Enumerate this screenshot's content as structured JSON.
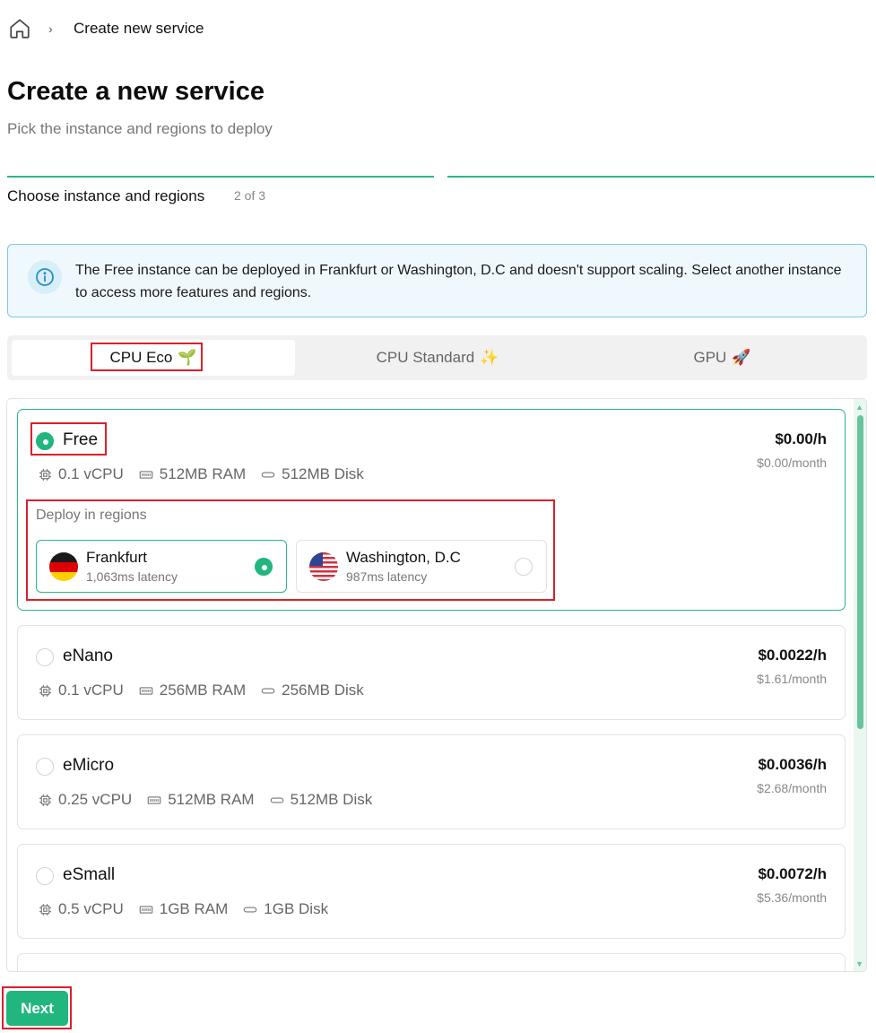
{
  "breadcrumb": {
    "home_icon": "home-icon",
    "separator": "›",
    "current": "Create new service"
  },
  "header": {
    "title": "Create a new service",
    "subtitle": "Pick the instance and regions to deploy"
  },
  "steps": {
    "label": "Choose instance and regions",
    "count": "2 of 3",
    "current": 2,
    "total": 3
  },
  "info": {
    "icon": "info-icon",
    "text": "The Free instance can be deployed in Frankfurt or Washington, D.C and doesn't support scaling. Select another instance to access more features and regions."
  },
  "tabs": [
    {
      "label": "CPU Eco",
      "emoji": "🌱",
      "active": true
    },
    {
      "label": "CPU Standard",
      "emoji": "✨",
      "active": false
    },
    {
      "label": "GPU",
      "emoji": "🚀",
      "active": false
    }
  ],
  "instances": [
    {
      "name": "Free",
      "selected": true,
      "cpu": "0.1 vCPU",
      "ram": "512MB RAM",
      "disk": "512MB Disk",
      "price": "$0.00/h",
      "month": "$0.00/month"
    },
    {
      "name": "eNano",
      "selected": false,
      "cpu": "0.1 vCPU",
      "ram": "256MB RAM",
      "disk": "256MB Disk",
      "price": "$0.0022/h",
      "month": "$1.61/month"
    },
    {
      "name": "eMicro",
      "selected": false,
      "cpu": "0.25 vCPU",
      "ram": "512MB RAM",
      "disk": "512MB Disk",
      "price": "$0.0036/h",
      "month": "$2.68/month"
    },
    {
      "name": "eSmall",
      "selected": false,
      "cpu": "0.5 vCPU",
      "ram": "1GB RAM",
      "disk": "1GB Disk",
      "price": "$0.0072/h",
      "month": "$5.36/month"
    }
  ],
  "regions": {
    "title": "Deploy in regions",
    "items": [
      {
        "name": "Frankfurt",
        "latency": "1,063ms latency",
        "flag": "germany-flag",
        "selected": true
      },
      {
        "name": "Washington, D.C",
        "latency": "987ms latency",
        "flag": "usa-flag",
        "selected": false
      }
    ]
  },
  "footer": {
    "next_label": "Next"
  },
  "colors": {
    "accent": "#22b67f",
    "highlight": "#d9202a",
    "info_bg": "#eff8fc",
    "info_border": "#7cc9e8"
  }
}
